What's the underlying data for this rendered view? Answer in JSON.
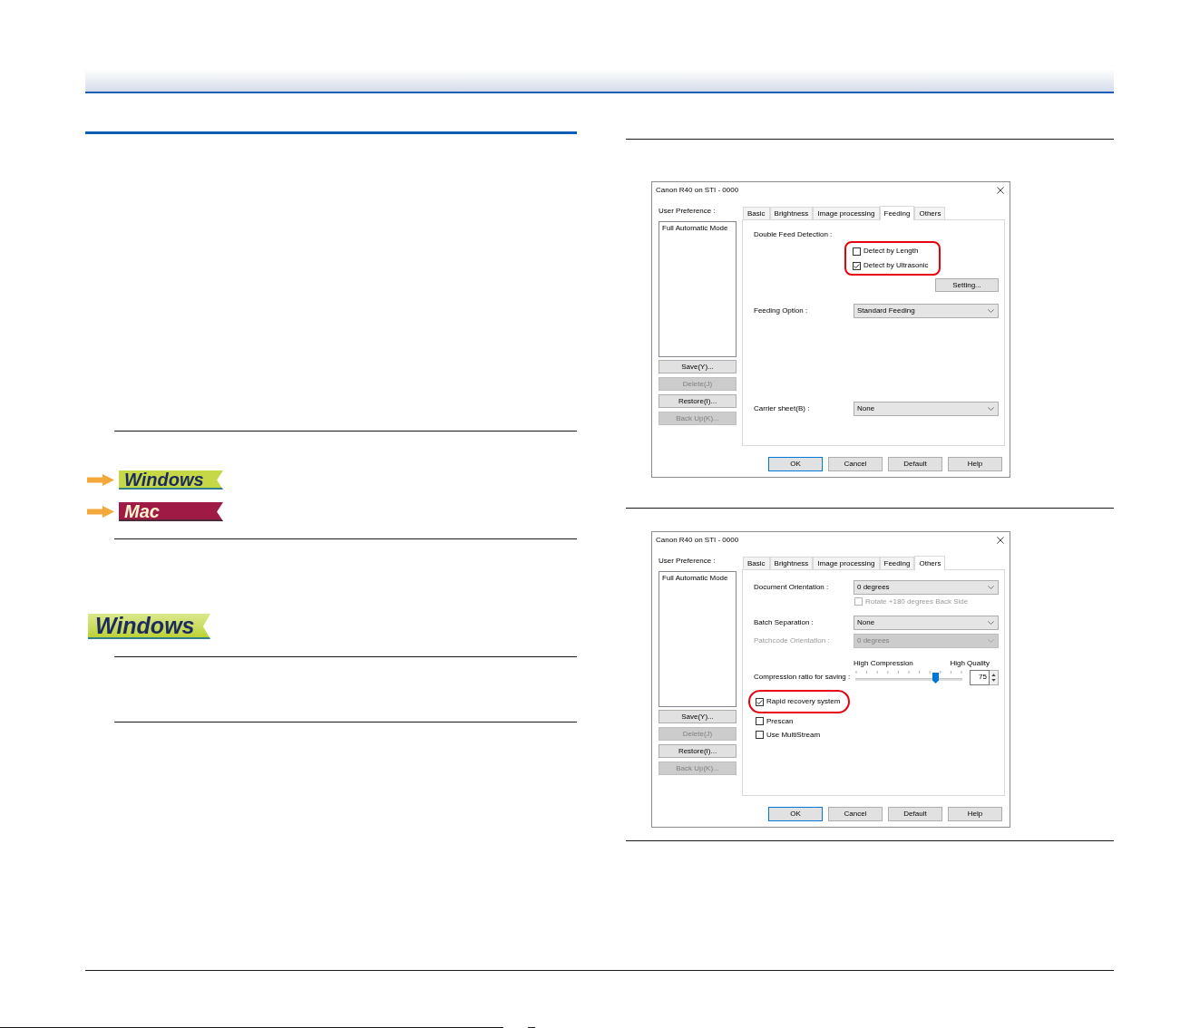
{
  "left_column": {
    "platform_links": [
      {
        "label": "Windows",
        "kind": "windows"
      },
      {
        "label": "Mac",
        "kind": "mac"
      }
    ],
    "platform_tag": {
      "label": "Windows",
      "kind": "windows"
    }
  },
  "right_column": {
    "dialogs": [
      {
        "title": "Canon R40 on STI - 0000",
        "user_preference": {
          "label": "User Preference :",
          "items": [
            {
              "label": "Full Automatic Mode",
              "selected": false
            }
          ],
          "buttons": [
            {
              "label": "Save(Y)...",
              "disabled": false
            },
            {
              "label": "Delete(J)",
              "disabled": true
            },
            {
              "label": "Restore(I)...",
              "disabled": false
            },
            {
              "label": "Back Up(K)...",
              "disabled": true
            }
          ]
        },
        "tabs": [
          {
            "label": "Basic",
            "selected": false
          },
          {
            "label": "Brightness",
            "selected": false
          },
          {
            "label": "Image processing",
            "selected": false
          },
          {
            "label": "Feeding",
            "selected": true
          },
          {
            "label": "Others",
            "selected": false
          }
        ],
        "page": {
          "kind": "feeding",
          "double_feed": {
            "label": "Double Feed Detection :",
            "highlighted": true,
            "options": [
              {
                "label": "Detect by Length",
                "checked": false
              },
              {
                "label": "Detect by Ultrasonic",
                "checked": true
              }
            ],
            "button": "Setting..."
          },
          "fields": [
            {
              "label": "Feeding Option :",
              "value": "Standard Feeding"
            },
            {
              "label": "Carrier sheet(B) :",
              "value": "None"
            }
          ]
        },
        "buttons": [
          {
            "label": "OK",
            "default": true
          },
          {
            "label": "Cancel",
            "default": false
          },
          {
            "label": "Default",
            "default": false
          },
          {
            "label": "Help",
            "default": false
          }
        ]
      },
      {
        "title": "Canon R40 on STI - 0000",
        "user_preference": {
          "label": "User Preference :",
          "items": [
            {
              "label": "Full Automatic Mode",
              "selected": false
            }
          ],
          "buttons": [
            {
              "label": "Save(Y)...",
              "disabled": false
            },
            {
              "label": "Delete(J)",
              "disabled": true
            },
            {
              "label": "Restore(I)...",
              "disabled": false
            },
            {
              "label": "Back Up(K)...",
              "disabled": true
            }
          ]
        },
        "tabs": [
          {
            "label": "Basic",
            "selected": false
          },
          {
            "label": "Brightness",
            "selected": false
          },
          {
            "label": "Image processing",
            "selected": false
          },
          {
            "label": "Feeding",
            "selected": false
          },
          {
            "label": "Others",
            "selected": true
          }
        ],
        "page": {
          "kind": "others",
          "fields": [
            {
              "label": "Document Orientation :",
              "value": "0 degrees",
              "disabled": false,
              "option": {
                "label": "Rotate +180 degrees Back Side",
                "checked": false,
                "disabled": true
              }
            },
            {
              "label": "Batch Separation :",
              "value": "None",
              "disabled": false
            },
            {
              "label": "Patchcode Orientation :",
              "value": "0 degrees",
              "disabled": true
            }
          ],
          "compression": {
            "label": "Compression ratio for saving :",
            "min_label": "High Compression",
            "max_label": "High Quality",
            "level": 0.75,
            "value": "75"
          },
          "options": [
            {
              "label": "Rapid recovery system",
              "checked": true,
              "highlighted": true
            },
            {
              "label": "Prescan",
              "checked": false,
              "highlighted": false
            },
            {
              "label": "Use MultiStream",
              "checked": false,
              "highlighted": false
            }
          ]
        },
        "buttons": [
          {
            "label": "OK",
            "default": true
          },
          {
            "label": "Cancel",
            "default": false
          },
          {
            "label": "Default",
            "default": false
          },
          {
            "label": "Help",
            "default": false
          }
        ]
      }
    ]
  }
}
